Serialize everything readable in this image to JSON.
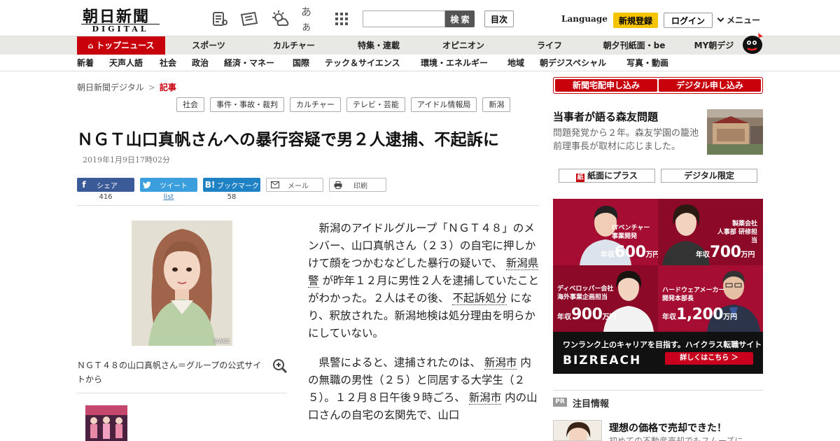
{
  "header": {
    "logo_main": "朝日新聞",
    "logo_sub": "DIGITAL",
    "search_placeholder": "",
    "search_button": "検 索",
    "toc_button": "目次",
    "language": "Language",
    "register": "新規登録",
    "login": "ログイン",
    "menu": "メニュー",
    "icons": [
      "news-icon",
      "paper-icon",
      "weather-icon",
      "font-size-icon",
      "grid-icon"
    ],
    "font_size_glyph": "あぁ"
  },
  "nav_main": [
    "トップニュース",
    "スポーツ",
    "カルチャー",
    "特集・連載",
    "オピニオン",
    "ライフ",
    "朝夕刊紙面・be",
    "MY朝デジ"
  ],
  "nav_sub": [
    "新着",
    "天声人語",
    "社会",
    "政治",
    "経済・マネー",
    "国際",
    "テック＆サイエンス",
    "環境・エネルギー",
    "地域",
    "朝デジスペシャル",
    "写真・動画"
  ],
  "breadcrumb": {
    "home": "朝日新聞デジタル",
    "separator": ">",
    "current": "記事"
  },
  "tags": [
    "社会",
    "事件・事故・裁判",
    "カルチャー",
    "テレビ・芸能",
    "アイドル情報局",
    "新潟"
  ],
  "article": {
    "headline": "ＮＧＴ山口真帆さんへの暴行容疑で男２人逮捕、不起訴に",
    "date": "2019年1月9日17時02分",
    "photo_credit": "©AKS",
    "caption": "ＮＧＴ４８の山口真帆さん＝グループの公式サイトから",
    "p1": [
      "新潟のアイドルグループ「ＮＧＴ４８」のメンバー、山口真帆さん（２３）の自宅に押しかけて顔をつかむなどした暴行の疑いで、",
      "新潟県警",
      "が昨年１２月に男性２人を逮捕していたことがわかった。２人はその後、",
      "不起訴処分",
      "になり、釈放された。新潟地検は処分理由を明らかにしていない。"
    ],
    "p2": [
      "県警によると、逮捕されたのは、",
      "新潟市",
      "内の無職の男性（２５）と同居する大学生（２５）。１２月８日午後９時ごろ、",
      "新潟市",
      "内の山口さんの自宅の玄関先で、山口"
    ]
  },
  "share": {
    "facebook": {
      "label": "シェア",
      "count": "416"
    },
    "twitter": {
      "label": "ツイート",
      "count": "list"
    },
    "hatena": {
      "label": "ブックマーク",
      "count": "58"
    },
    "mail": "メール",
    "print": "印刷"
  },
  "sidebar": {
    "subscribe_paper": "新聞宅配申し込み",
    "subscribe_digital": "デジタル申し込み",
    "feature_title": "当事者が語る森友問題",
    "feature_text": "問題発覚から２年。森友学園の籠池前理事長が取材に応じました。",
    "btn_plus": "紙面にプラス",
    "btn_digital": "デジタル限定",
    "pr_badge": "PR",
    "pr_title": "注目情報",
    "pr_headline": "理想の価格で売却できた！",
    "pr_sub": "初めての不動産売却でもスムーズに"
  },
  "ad": {
    "cells": [
      {
        "job": [
          "ITベンチャー",
          "事業開発"
        ],
        "prefix": "年収",
        "amount": "600",
        "unit": "万円"
      },
      {
        "job": [
          "製薬会社",
          "人事部 研修担当"
        ],
        "prefix": "年収",
        "amount": "700",
        "unit": "万円"
      },
      {
        "job": [
          "ディベロッパー会社",
          "海外事業企画担当"
        ],
        "prefix": "年収",
        "amount": "900",
        "unit": "万円"
      },
      {
        "job": [
          "ハードウェアメーカー",
          "開発本部長"
        ],
        "prefix": "年収",
        "amount": "1,200",
        "unit": "万円"
      }
    ],
    "catch": "ワンランク上のキャリアを目指す。ハイクラス転職サイト",
    "brand": "BIZREACH",
    "cta": "詳しくはこちら ＞"
  },
  "colors": {
    "brand_red": "#c8000c",
    "yellow": "#f5c400",
    "ad_red": "#9d0b2f"
  }
}
